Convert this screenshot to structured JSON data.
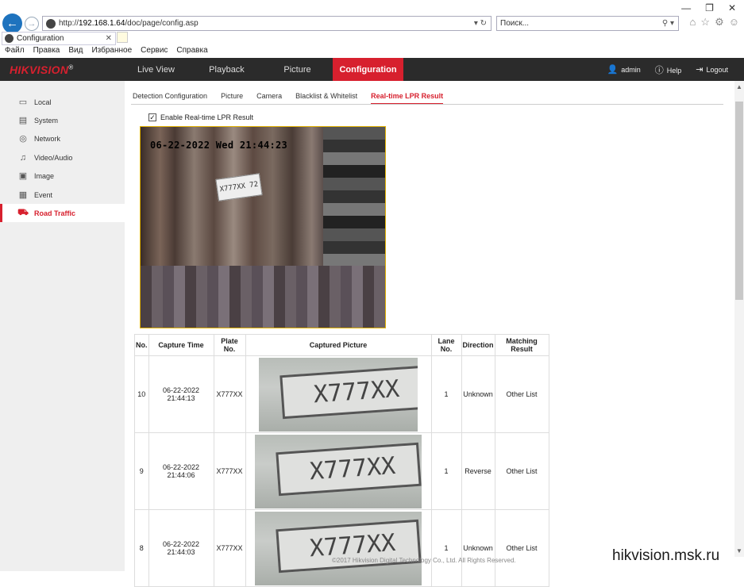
{
  "browser": {
    "url_prefix": "http://",
    "url_host": "192.168.1.64",
    "url_path": "/doc/page/config.asp",
    "address_tools": "▾ ↻",
    "search_placeholder": "Поиск...",
    "search_tools": "⚲ ▾",
    "tab_title": "Configuration",
    "menu": [
      "Файл",
      "Правка",
      "Вид",
      "Избранное",
      "Сервис",
      "Справка"
    ]
  },
  "app": {
    "logo": "HIKVISION",
    "nav": [
      "Live View",
      "Playback",
      "Picture",
      "Configuration"
    ],
    "user": "admin",
    "help": "Help",
    "logout": "Logout"
  },
  "sidebar": {
    "items": [
      {
        "label": "Local",
        "icon": "monitor-icon"
      },
      {
        "label": "System",
        "icon": "system-icon"
      },
      {
        "label": "Network",
        "icon": "network-icon"
      },
      {
        "label": "Video/Audio",
        "icon": "mic-icon"
      },
      {
        "label": "Image",
        "icon": "image-icon"
      },
      {
        "label": "Event",
        "icon": "calendar-icon"
      },
      {
        "label": "Road Traffic",
        "icon": "road-traffic-icon"
      }
    ]
  },
  "subtabs": [
    "Detection Configuration",
    "Picture",
    "Camera",
    "Blacklist & Whitelist",
    "Real-time LPR Result"
  ],
  "enable_label": "Enable Real-time LPR Result",
  "video": {
    "timestamp": "06-22-2022 Wed 21:44:23",
    "plate_text": "X777XX 72"
  },
  "table": {
    "headers": [
      "No.",
      "Capture Time",
      "Plate No.",
      "Captured Picture",
      "Lane No.",
      "Direction",
      "Matching Result"
    ],
    "rows": [
      {
        "no": "10",
        "time": "06-22-2022 21:44:13",
        "plate": "X777XX",
        "pic": "X777XX",
        "lane": "1",
        "direction": "Unknown",
        "match": "Other List"
      },
      {
        "no": "9",
        "time": "06-22-2022 21:44:06",
        "plate": "X777XX",
        "pic": "X777XX",
        "lane": "1",
        "direction": "Reverse",
        "match": "Other List"
      },
      {
        "no": "8",
        "time": "06-22-2022 21:44:03",
        "plate": "X777XX",
        "pic": "X777XX",
        "lane": "1",
        "direction": "Unknown",
        "match": "Other List"
      }
    ]
  },
  "footer": "©2017 Hikvision Digital Technology Co., Ltd. All Rights Reserved.",
  "watermark": "hikvision.msk.ru"
}
